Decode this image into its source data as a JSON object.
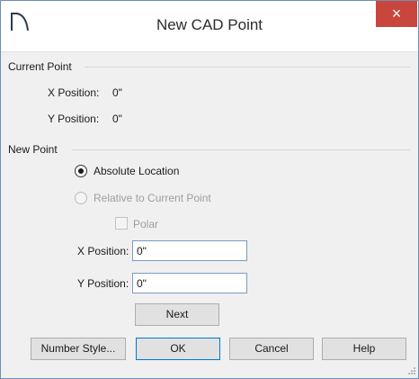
{
  "window": {
    "title": "New CAD Point",
    "close_glyph": "×",
    "app_icon": "chief-architect-logo-icon"
  },
  "current_point": {
    "group_label": "Current Point",
    "x_label": "X Position:",
    "x_value": "0\"",
    "y_label": "Y Position:",
    "y_value": "0\""
  },
  "new_point": {
    "group_label": "New Point",
    "absolute_label": "Absolute Location",
    "absolute_selected": true,
    "relative_label": "Relative to Current Point",
    "relative_enabled": false,
    "polar_label": "Polar",
    "polar_checked": false,
    "x_label": "X Position:",
    "x_value": "0\"",
    "y_label": "Y Position:",
    "y_value": "0\"",
    "next_label": "Next"
  },
  "buttons": {
    "number_style": "Number Style...",
    "ok": "OK",
    "cancel": "Cancel",
    "help": "Help"
  },
  "colors": {
    "close_button": "#c9463d",
    "dialog_background": "#f0f0f0",
    "input_border": "#7a9cc6",
    "default_button_border": "#0078d7"
  }
}
